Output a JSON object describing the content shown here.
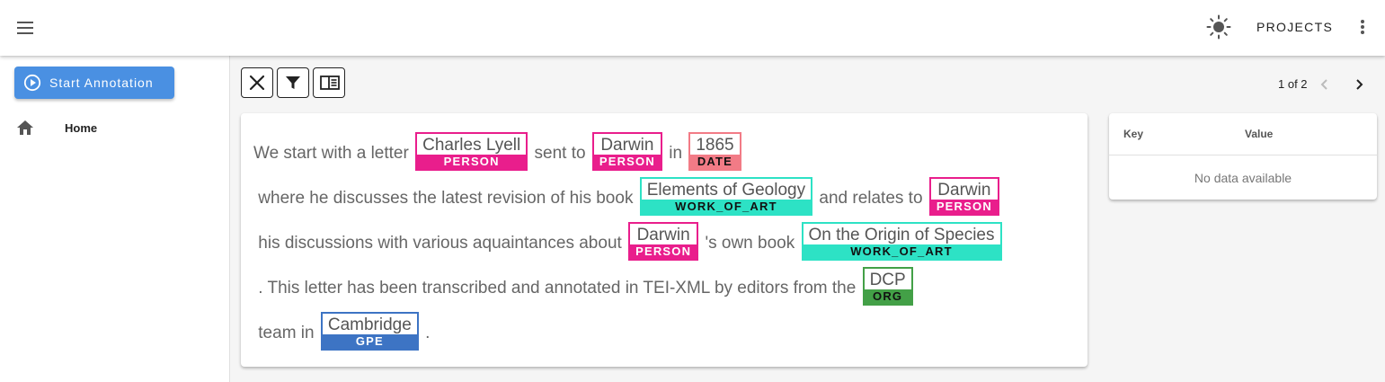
{
  "appbar": {
    "projects_label": "PROJECTS",
    "icons": [
      "menu-icon",
      "sun-icon",
      "more-vert-icon"
    ]
  },
  "sidebar": {
    "start_label": "Start Annotation",
    "home_label": "Home"
  },
  "toolbar": {
    "icons": [
      "close-icon",
      "filter-icon",
      "sidebar-toggle-icon"
    ]
  },
  "pager": {
    "text": "1 of 2"
  },
  "document": {
    "segments": [
      {
        "type": "text",
        "text": "We start with a letter "
      },
      {
        "type": "entity",
        "text": "Charles Lyell",
        "label": "PERSON",
        "color": "#e91e8c"
      },
      {
        "type": "text",
        "text": " sent to "
      },
      {
        "type": "entity",
        "text": "Darwin",
        "label": "PERSON",
        "color": "#e91e8c"
      },
      {
        "type": "text",
        "text": " in "
      },
      {
        "type": "entity",
        "text": "1865",
        "label": "DATE",
        "color": "#f27b86"
      },
      {
        "type": "text",
        "text": " where he discusses the latest revision of his book "
      },
      {
        "type": "entity",
        "text": "Elements of Geology",
        "label": "WORK_OF_ART",
        "color": "#2de2c5"
      },
      {
        "type": "text",
        "text": " and relates to "
      },
      {
        "type": "entity",
        "text": "Darwin",
        "label": "PERSON",
        "color": "#e91e8c"
      },
      {
        "type": "text",
        "text": " his discussions with various aquaintances about "
      },
      {
        "type": "entity",
        "text": "Darwin",
        "label": "PERSON",
        "color": "#e91e8c"
      },
      {
        "type": "text",
        "text": " 's own book "
      },
      {
        "type": "entity",
        "text": "On the Origin of Species",
        "label": "WORK_OF_ART",
        "color": "#2de2c5"
      },
      {
        "type": "text",
        "text": " . This letter has been transcribed and annotated in TEI-XML by editors from the "
      },
      {
        "type": "entity",
        "text": "DCP",
        "label": "ORG",
        "color": "#43a047"
      },
      {
        "type": "text",
        "text": " team in "
      },
      {
        "type": "entity",
        "text": "Cambridge",
        "label": "GPE",
        "color": "#3d74c4"
      },
      {
        "type": "text",
        "text": " ."
      }
    ]
  },
  "kv_table": {
    "key_header": "Key",
    "value_header": "Value",
    "empty_text": "No data available"
  },
  "colors": {
    "accent": "#4a90e2",
    "PERSON": "#e91e8c",
    "DATE": "#f27b86",
    "WORK_OF_ART": "#2de2c5",
    "ORG": "#43a047",
    "GPE": "#3d74c4"
  }
}
